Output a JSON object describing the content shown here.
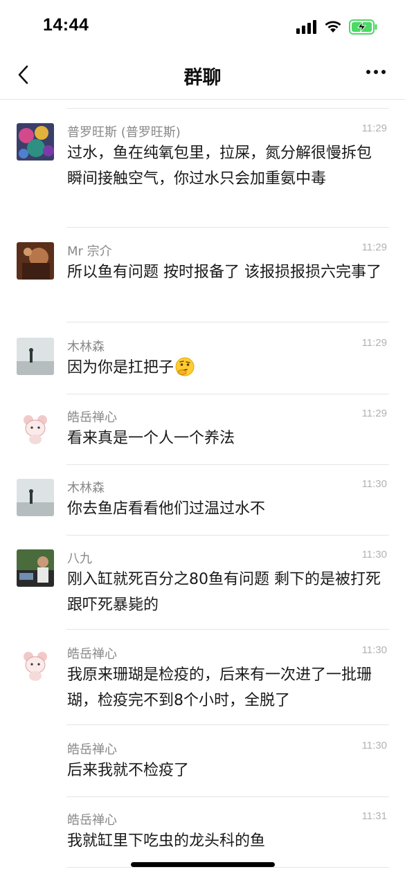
{
  "status_bar": {
    "time": "14:44"
  },
  "nav": {
    "title": "群聊"
  },
  "messages": [
    {
      "sender": "普罗旺斯 (普罗旺斯)",
      "time": "11:29",
      "text": "过水，鱼在纯氧包里，拉屎，氮分解很慢拆包瞬间接触空气，你过水只会加重氨中毒"
    },
    {
      "sender": "Mr 宗介",
      "time": "11:29",
      "text": "所以鱼有问题  按时报备了  该报损报损六完事了"
    },
    {
      "sender": "木林森",
      "time": "11:29",
      "text": "因为你是扛把子"
    },
    {
      "sender": "皓岳禅心",
      "time": "11:29",
      "text": "看来真是一个人一个养法"
    },
    {
      "sender": "木林森",
      "time": "11:30",
      "text": "你去鱼店看看他们过温过水不"
    },
    {
      "sender": "八九",
      "time": "11:30",
      "text": "刚入缸就死百分之80鱼有问题 剩下的是被打死跟吓死暴毙的"
    },
    {
      "sender": "皓岳禅心",
      "time": "11:30",
      "text": "我原来珊瑚是检疫的，后来有一次进了一批珊瑚，检疫完不到8个小时，全脱了"
    },
    {
      "sender": "皓岳禅心",
      "time": "11:30",
      "text": "后来我就不检疫了"
    },
    {
      "sender": "皓岳禅心",
      "time": "11:31",
      "text": "我就缸里下吃虫的龙头科的鱼"
    }
  ],
  "icons": {
    "back": "chevron-left-icon",
    "more": "more-dots-icon",
    "emoji": "thinking-face-emoji",
    "signal": "signal-icon",
    "wifi": "wifi-icon",
    "battery": "battery-charging-icon"
  },
  "colors": {
    "battery_fill": "#4cd964",
    "meta_text": "#888888",
    "time_text": "#b2b2b2"
  }
}
